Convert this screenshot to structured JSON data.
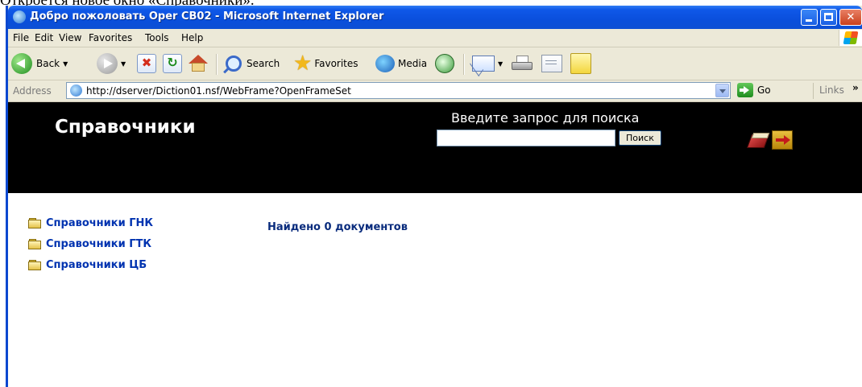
{
  "document_text": "Откроется новое окно «Справочники».",
  "window": {
    "title": "Добро пожоловать Oper CB02 - Microsoft Internet Explorer"
  },
  "menu": [
    {
      "label": "File"
    },
    {
      "label": "Edit"
    },
    {
      "label": "View"
    },
    {
      "label": "Favorites"
    },
    {
      "label": "Tools"
    },
    {
      "label": "Help"
    }
  ],
  "toolbar": {
    "back_label": "Back",
    "search_label": "Search",
    "favorites_label": "Favorites",
    "media_label": "Media"
  },
  "addressbar": {
    "label": "Address",
    "url": "http://dserver/Diction01.nsf/WebFrame?OpenFrameSet",
    "go_label": "Go",
    "links_label": "Links"
  },
  "page": {
    "title": "Справочники",
    "search_caption": "Введите запрос для поиска",
    "search_value": "",
    "search_button": "Поиск",
    "nav_items": [
      {
        "label": "Справочники ГНК"
      },
      {
        "label": "Справочники ГТК"
      },
      {
        "label": "Справочники ЦБ"
      }
    ],
    "results_text": "Найдено 0 документов"
  },
  "colors": {
    "titlebar": "#0a4fdc",
    "header_bg": "#000000",
    "nav_link": "#0033b0",
    "results_text": "#0a2c7d"
  }
}
